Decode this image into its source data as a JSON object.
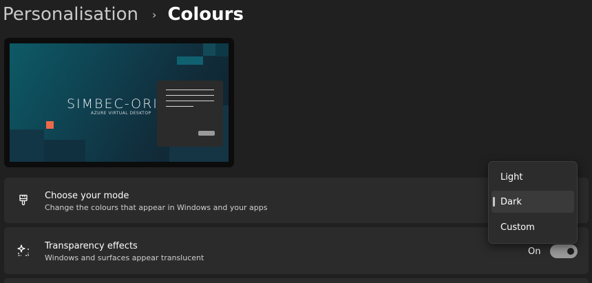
{
  "breadcrumb": {
    "parent": "Personalisation",
    "separator": "›",
    "current": "Colours"
  },
  "preview": {
    "brand": "SIMBEC-ORIC",
    "brand_sub": "AZURE VIRTUAL DESKTOP",
    "accent_color": "#ec6a48"
  },
  "mode_setting": {
    "icon": "paintbrush-icon",
    "title": "Choose your mode",
    "description": "Change the colours that appear in Windows and your apps",
    "options": [
      "Light",
      "Dark",
      "Custom"
    ],
    "selected": "Dark"
  },
  "transparency_setting": {
    "icon": "sparkle-icon",
    "title": "Transparency effects",
    "description": "Windows and surfaces appear translucent",
    "state_label": "On",
    "enabled": true
  }
}
